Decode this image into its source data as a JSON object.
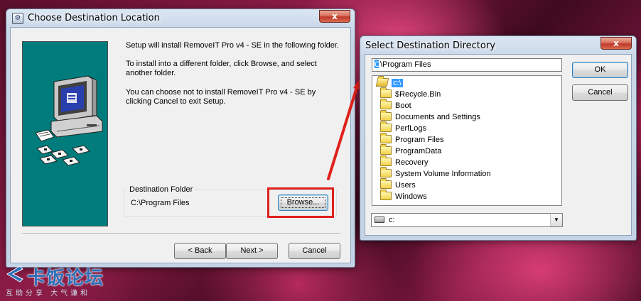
{
  "setup_window": {
    "title": "Choose Destination Location",
    "close_label": "x",
    "message_1": "Setup will install RemoveIT Pro v4 - SE in the following folder.",
    "message_2_line1": "To install into a different folder, click Browse, and select",
    "message_2_line2": "another folder.",
    "message_3_line1": "You can choose not to install RemoveIT Pro v4 - SE by",
    "message_3_line2": "clicking Cancel to exit Setup.",
    "destination_group_label": "Destination Folder",
    "destination_path": "C:\\Program Files",
    "browse_label": "Browse...",
    "back_label": "< Back",
    "next_label": "Next >",
    "cancel_label": "Cancel"
  },
  "dir_dialog": {
    "title": "Select Destination Directory",
    "close_label": "x",
    "path_value": "\\Program Files",
    "path_first_char": "C",
    "ok_label": "OK",
    "cancel_label": "Cancel",
    "tree_root": "c:\\",
    "folders": [
      "$Recycle.Bin",
      "Boot",
      "Documents and Settings",
      "PerfLogs",
      "Program Files",
      "ProgramData",
      "Recovery",
      "System Volume Information",
      "Users",
      "Windows"
    ],
    "drive_value": "c:"
  },
  "watermark": {
    "title": "卡饭论坛",
    "subtitle": "互助分享   大气谦和"
  },
  "colors": {
    "teal_panel": "#007c7c",
    "highlight_red": "#e0201c",
    "selection_blue": "#3399ff"
  }
}
